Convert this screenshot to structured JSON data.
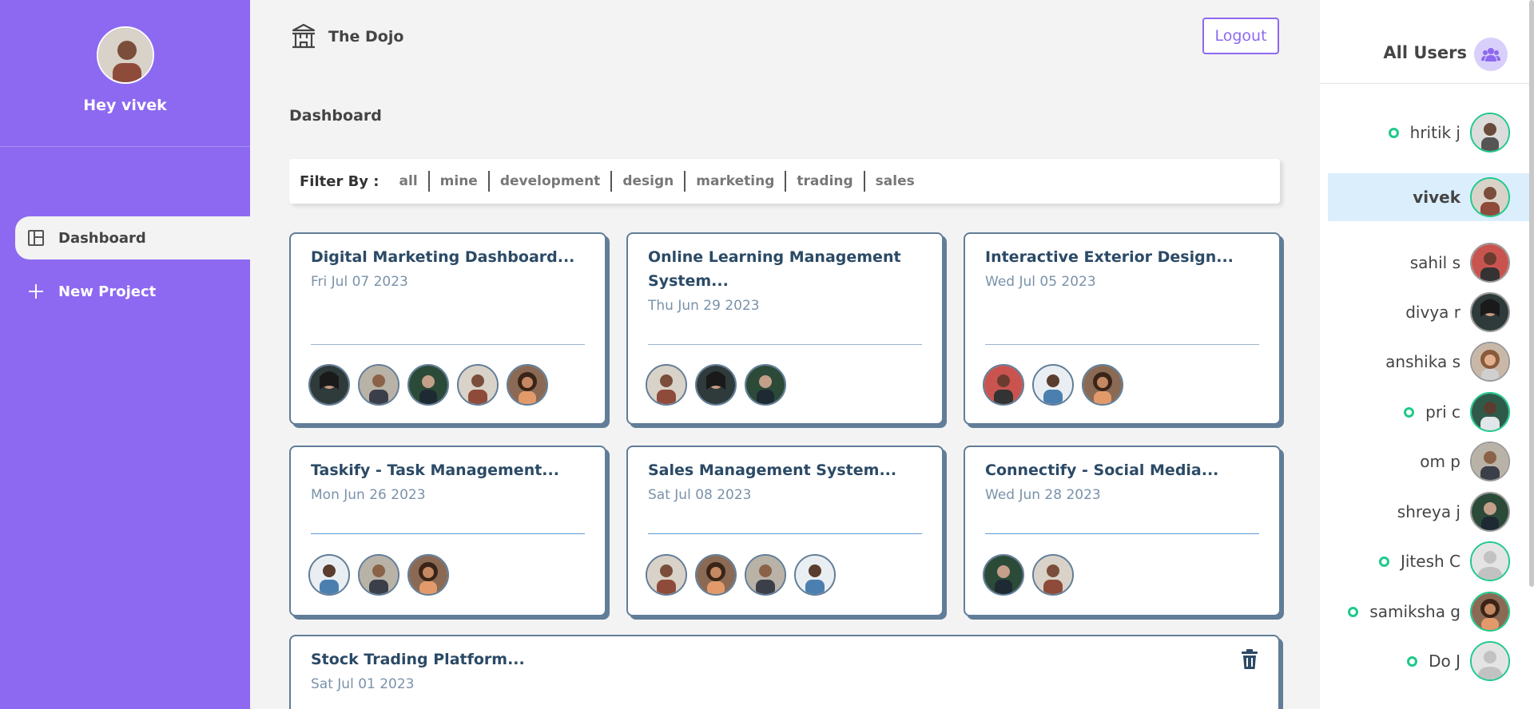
{
  "sidebar": {
    "greeting": "Hey vivek",
    "nav": [
      {
        "label": "Dashboard",
        "icon": "dashboard-icon"
      },
      {
        "label": "New Project",
        "icon": "plus-icon"
      }
    ]
  },
  "navbar": {
    "brand": "The Dojo",
    "brand_icon": "temple-icon",
    "logout": "Logout"
  },
  "page_title": "Dashboard",
  "filter": {
    "label": "Filter By :",
    "options": [
      "all",
      "mine",
      "development",
      "design",
      "marketing",
      "trading",
      "sales"
    ]
  },
  "projects": [
    {
      "title": "Digital Marketing Dashboard...",
      "date": "Fri Jul 07 2023"
    },
    {
      "title": "Online Learning Management System...",
      "title_line1": "Online Learning Management",
      "title_line2": "System...",
      "date": "Thu Jun 29 2023"
    },
    {
      "title": "Interactive Exterior Design...",
      "date": "Wed Jul 05 2023"
    },
    {
      "title": "Taskify - Task Management...",
      "date": "Mon Jun 26 2023"
    },
    {
      "title": "Sales Management System...",
      "date": "Sat Jul 08 2023"
    },
    {
      "title": "Connectify - Social Media...",
      "date": "Wed Jun 28 2023"
    },
    {
      "title": "Stock Trading Platform...",
      "date": "Sat Jul 01 2023"
    }
  ],
  "users_panel": {
    "title": "All Users",
    "users": [
      {
        "name": "hritik j",
        "online": true
      },
      {
        "name": "vivek",
        "online": false,
        "current": true
      },
      {
        "name": "sahil s",
        "online": false
      },
      {
        "name": "divya r",
        "online": false
      },
      {
        "name": "anshika s",
        "online": false
      },
      {
        "name": "pri c",
        "online": true
      },
      {
        "name": "om p",
        "online": false
      },
      {
        "name": "shreya j",
        "online": false
      },
      {
        "name": "Jitesh C",
        "online": true
      },
      {
        "name": "samiksha g",
        "online": true
      },
      {
        "name": "Do J",
        "online": true
      }
    ]
  },
  "colors": {
    "sidebar": "#8d69f1",
    "card_border": "#617d98",
    "card_title": "#2b4a66",
    "online": "#1ec98a",
    "active_user_bg": "#dbeefc"
  }
}
